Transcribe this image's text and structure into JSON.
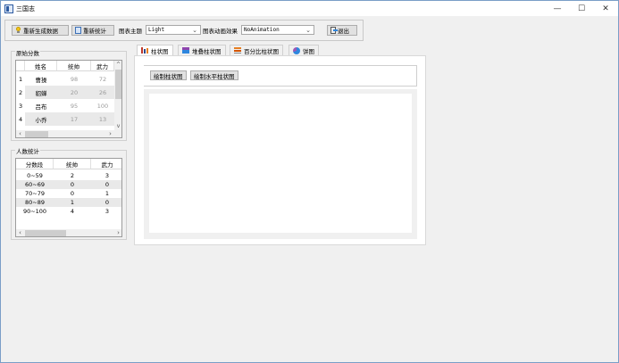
{
  "window": {
    "title": "三国志",
    "minimize": "—",
    "maximize": "☐",
    "close": "✕"
  },
  "toolbar": {
    "regenerate_label": "重新生成数据",
    "recount_label": "重新统计",
    "theme_label": "图表主题",
    "theme_value": "Light",
    "animation_label": "图表动画效果",
    "animation_value": "NoAnimation",
    "exit_label": "退出"
  },
  "scores": {
    "title": "原始分数",
    "columns": [
      "姓名",
      "统帅",
      "武力"
    ],
    "rows": [
      {
        "num": "1",
        "name": "曹操",
        "lead": "98",
        "force": "72"
      },
      {
        "num": "2",
        "name": "貂蝉",
        "lead": "20",
        "force": "26"
      },
      {
        "num": "3",
        "name": "吕布",
        "lead": "95",
        "force": "100"
      },
      {
        "num": "4",
        "name": "小乔",
        "lead": "17",
        "force": "13"
      }
    ]
  },
  "stats": {
    "title": "人数统计",
    "columns": [
      "分数段",
      "统帅",
      "武力"
    ],
    "rows": [
      {
        "range": "0~59",
        "lead": "2",
        "force": "3"
      },
      {
        "range": "60~69",
        "lead": "0",
        "force": "0"
      },
      {
        "range": "70~79",
        "lead": "0",
        "force": "1"
      },
      {
        "range": "80~89",
        "lead": "1",
        "force": "0"
      },
      {
        "range": "90~100",
        "lead": "4",
        "force": "3"
      }
    ]
  },
  "tabs": [
    {
      "label": "柱状图",
      "active": true,
      "icon_color": "#c0392b"
    },
    {
      "label": "堆叠柱状图",
      "active": false,
      "icon_color": "#8e44ad"
    },
    {
      "label": "百分比柱状图",
      "active": false,
      "icon_color": "#d35400"
    },
    {
      "label": "饼图",
      "active": false,
      "icon_color": "#2e86de"
    }
  ],
  "bar_tab": {
    "draw_bar_label": "绘制柱状图",
    "draw_hbar_label": "绘制水平柱状图"
  }
}
